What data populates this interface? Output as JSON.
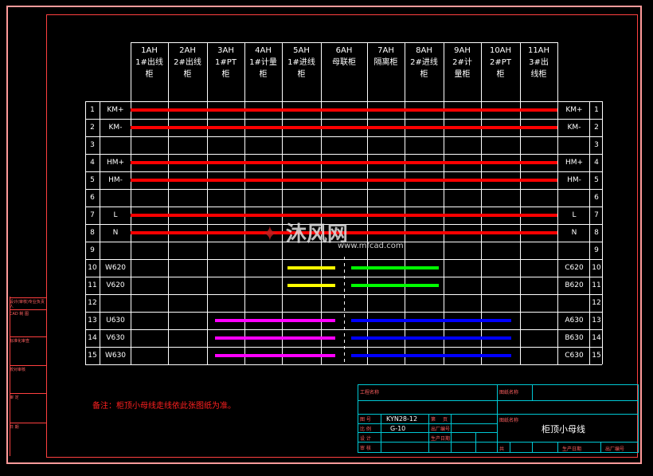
{
  "columns": [
    {
      "code": "1AH",
      "line2": "1#出线",
      "line3": "柜"
    },
    {
      "code": "2AH",
      "line2": "2#出线",
      "line3": "柜"
    },
    {
      "code": "3AH",
      "line2": "1#PT",
      "line3": "柜"
    },
    {
      "code": "4AH",
      "line2": "1#计量",
      "line3": "柜"
    },
    {
      "code": "5AH",
      "line2": "1#进线",
      "line3": "柜"
    },
    {
      "code": "6AH",
      "line2": "母联柜",
      "line3": ""
    },
    {
      "code": "7AH",
      "line2": "隔离柜",
      "line3": ""
    },
    {
      "code": "8AH",
      "line2": "2#进线",
      "line3": "柜"
    },
    {
      "code": "9AH",
      "line2": "2#计",
      "line3": "量柜"
    },
    {
      "code": "10AH",
      "line2": "2#PT",
      "line3": "柜"
    },
    {
      "code": "11AH",
      "line2": "3#出",
      "line3": "线柜"
    }
  ],
  "rows": [
    {
      "num": "1",
      "left": "KM+",
      "right": "KM+"
    },
    {
      "num": "2",
      "left": "KM-",
      "right": "KM-"
    },
    {
      "num": "3",
      "left": "",
      "right": ""
    },
    {
      "num": "4",
      "left": "HM+",
      "right": "HM+"
    },
    {
      "num": "5",
      "left": "HM-",
      "right": "HM-"
    },
    {
      "num": "6",
      "left": "",
      "right": ""
    },
    {
      "num": "7",
      "left": "L",
      "right": "L"
    },
    {
      "num": "8",
      "left": "N",
      "right": "N"
    },
    {
      "num": "9",
      "left": "",
      "right": ""
    },
    {
      "num": "10",
      "left": "W620",
      "right": "C620"
    },
    {
      "num": "11",
      "left": "V620",
      "right": "B620"
    },
    {
      "num": "12",
      "left": "",
      "right": ""
    },
    {
      "num": "13",
      "left": "U630",
      "right": "A630"
    },
    {
      "num": "14",
      "left": "V630",
      "right": "B630"
    },
    {
      "num": "15",
      "left": "W630",
      "right": "C630"
    }
  ],
  "colors": {
    "red": "#ff0000",
    "yellow": "#ffff00",
    "green": "#00ff00",
    "magenta": "#ff00ff",
    "blue": "#0000ff"
  },
  "note": "备注：柜顶小母线走线依此张图纸为准。",
  "side_labels": [
    "设计(审核)专业负责人",
    "CAD 制 图",
    "标准化审查",
    "校对审核",
    "审 定",
    "日 期"
  ],
  "title_block": {
    "project_label": "工程名称",
    "drawing_label": "图纸名称",
    "model": "KYN28-12",
    "code": "G-10",
    "sheet_label": "图纸名称",
    "title": "柜顶小母线",
    "labels": [
      "图 号",
      "比 例",
      "设 计",
      "审 核",
      "批 准",
      "第",
      "页",
      "共",
      "页",
      "生产日期",
      "出厂编号"
    ]
  },
  "watermark": {
    "brand": "沐风网",
    "url": "www.mfcad.com"
  }
}
